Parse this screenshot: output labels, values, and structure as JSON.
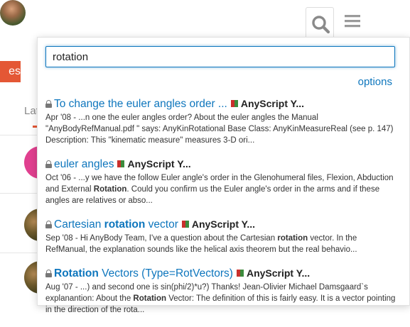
{
  "search": {
    "value": "rotation",
    "options_label": "options"
  },
  "background": {
    "tag_text": "es",
    "latest_label": "Late"
  },
  "colors": {
    "accent": "#0e76bd",
    "brand": "#e45735",
    "category_red": "#c9302c",
    "category_green": "#3c8b3c"
  },
  "results": [
    {
      "title_parts": [
        {
          "t": "To change the euler angles order ...",
          "hl": false
        }
      ],
      "category": "AnyScript Y...",
      "blurb_parts": [
        {
          "t": "Apr '08 - ...n one the euler angles order? About the euler angles the Manual \"AnyBodyRefManual.pdf \" says: AnyKinRotational Base Class: AnyKinMeasureReal (see p. 147) Description: This \"kinematic measure\" measures 3-D ori...",
          "b": false
        }
      ]
    },
    {
      "title_parts": [
        {
          "t": "euler angles",
          "hl": false
        }
      ],
      "category": "AnyScript Y...",
      "blurb_parts": [
        {
          "t": "Oct '06 - ...y we have the follow Euler angle's order in the Glenohumeral files, Flexion, Abduction and External ",
          "b": false
        },
        {
          "t": "Rotation",
          "b": true
        },
        {
          "t": ". Could you confirm us the Euler angle's order in the arms and if these angles are relatives or abso...",
          "b": false
        }
      ]
    },
    {
      "title_parts": [
        {
          "t": "Cartesian ",
          "hl": false
        },
        {
          "t": "rotation",
          "hl": true
        },
        {
          "t": " vector",
          "hl": false
        }
      ],
      "category": "AnyScript Y...",
      "blurb_parts": [
        {
          "t": "Sep '08 - Hi AnyBody Team, I've a question about the Cartesian ",
          "b": false
        },
        {
          "t": "rotation",
          "b": true
        },
        {
          "t": " vector. In the RefManual, the explanation sounds like the helical axis theorem but the real behavio...",
          "b": false
        }
      ]
    },
    {
      "title_parts": [
        {
          "t": "Rotation",
          "hl": true
        },
        {
          "t": " Vectors (Type=RotVectors)",
          "hl": false
        }
      ],
      "category": "AnyScript Y...",
      "blurb_parts": [
        {
          "t": "Aug '07 - ...) and second one is sin(phi/2)*u?) Thanks! Jean-Olivier Michael Damsgaard`s explanantion: About the ",
          "b": false
        },
        {
          "t": "Rotation",
          "b": true
        },
        {
          "t": " Vector: The definition of this is fairly easy. It is a vector pointing in the direction of the rota...",
          "b": false
        }
      ]
    }
  ]
}
